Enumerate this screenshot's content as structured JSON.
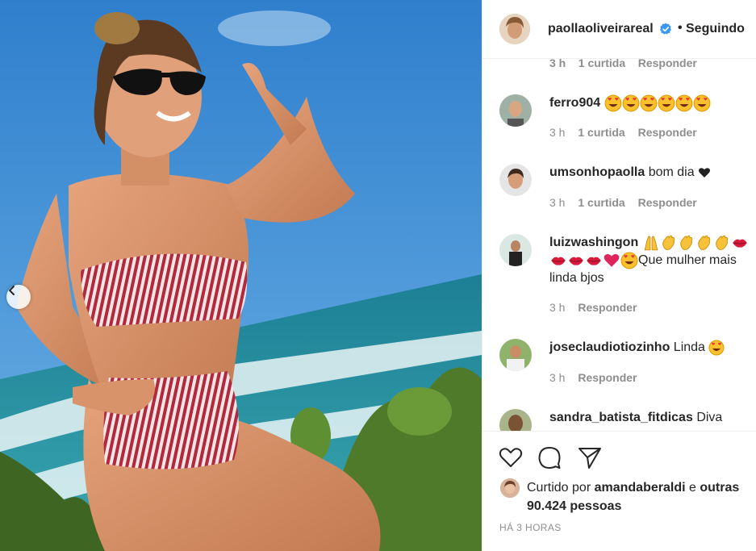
{
  "post": {
    "photo_alt": "",
    "prev_icon": "chevron-left-icon"
  },
  "header": {
    "username": "paollaoliveirareal",
    "verified_icon": "verified-badge-icon",
    "separator": "•",
    "follow_label": "Seguindo"
  },
  "comments": [
    {
      "username": "ferro904",
      "text": "",
      "emojis": [
        "heart-eyes",
        "heart-eyes",
        "heart-eyes",
        "heart-eyes",
        "heart-eyes",
        "heart-eyes"
      ],
      "time": "3 h",
      "likes": "1 curtida",
      "reply": "Responder"
    },
    {
      "username": "umsonhopaolla",
      "text": "bom dia",
      "emojis_after": [
        "black-heart"
      ],
      "time": "3 h",
      "likes": "1 curtida",
      "reply": "Responder"
    },
    {
      "username": "luizwashingon",
      "text": "Que mulher mais linda bjos",
      "time": "3 h",
      "reply": "Responder"
    },
    {
      "username": "joseclaudiotiozinho",
      "text": "Linda",
      "time": "3 h",
      "reply": "Responder"
    },
    {
      "username": "sandra_batista_fitdicas",
      "text": "Diva"
    }
  ],
  "ghost_meta": {
    "time": "3 h",
    "likes": "1 curtida",
    "reply": "Responder"
  },
  "actions": {
    "like_icon": "heart-outline-icon",
    "comment_icon": "comment-icon",
    "share_icon": "paper-plane-icon"
  },
  "likes": {
    "prefix": "Curtido por",
    "user": "amandaberaldi",
    "joiner": "e",
    "others": "outras 90.424 pessoas"
  },
  "timestamp": "HÁ 3 HORAS",
  "colors": {
    "text": "#262626",
    "muted": "#8e8e8e",
    "verified": "#3897f0",
    "border": "#efefef"
  }
}
